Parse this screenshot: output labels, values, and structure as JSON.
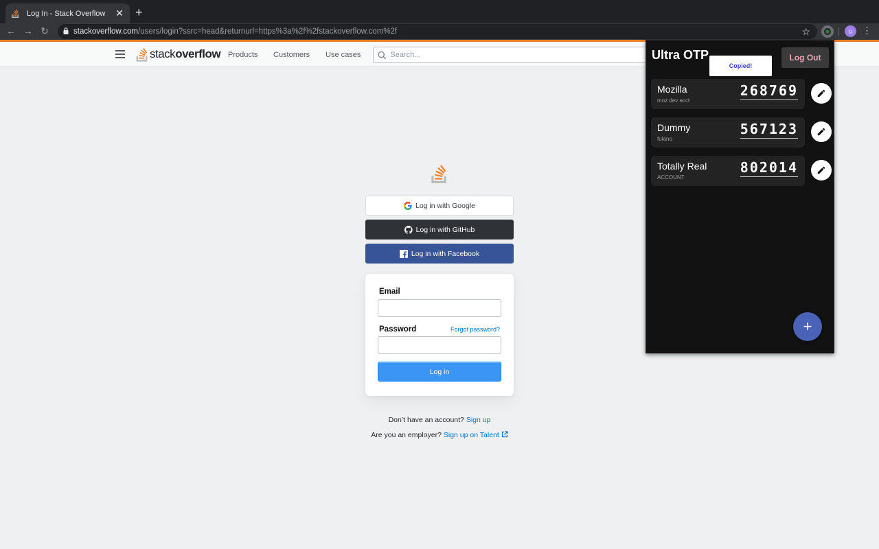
{
  "browser": {
    "tab_title": "Log In - Stack Overflow",
    "tab_close": "✕",
    "new_tab": "+",
    "url_host": "stackoverflow.com",
    "url_path": "/users/login?ssrc=head&returnurl=https%3a%2f%2fstackoverflow.com%2f",
    "back": "←",
    "forward": "→",
    "reload": "↻",
    "star": "☆",
    "menu": "⋮"
  },
  "so_header": {
    "logo_light": "stack",
    "logo_bold": "overflow",
    "nav": [
      "Products",
      "Customers",
      "Use cases"
    ],
    "search_placeholder": "Search..."
  },
  "login": {
    "google_label": "Log in with Google",
    "github_label": "Log in with GitHub",
    "facebook_label": "Log in with Facebook",
    "email_label": "Email",
    "password_label": "Password",
    "forgot_label": "Forgot password?",
    "submit_label": "Log in",
    "signup_text": "Don’t have an account?",
    "signup_link": "Sign up",
    "employer_text": "Are you an employer?",
    "employer_link": "Sign up on Talent"
  },
  "otp": {
    "title": "Ultra OTP",
    "toast": "Copied!",
    "logout_label": "Log Out",
    "fab_label": "+",
    "accounts": [
      {
        "name": "Mozilla",
        "sub": "moz dev acct",
        "code": "268769"
      },
      {
        "name": "Dummy",
        "sub": "fulano",
        "code": "567123"
      },
      {
        "name": "Totally Real",
        "sub": "ACCOUNT",
        "code": "802014"
      }
    ]
  },
  "colors": {
    "so_orange": "#f48024",
    "so_blue": "#0074cc",
    "login_blue": "#3b95f5",
    "github_dark": "#2f3337",
    "facebook_blue": "#385499",
    "otp_bg": "#121212",
    "otp_fab": "#4a62b8",
    "logout_text": "#f4a3b5"
  }
}
